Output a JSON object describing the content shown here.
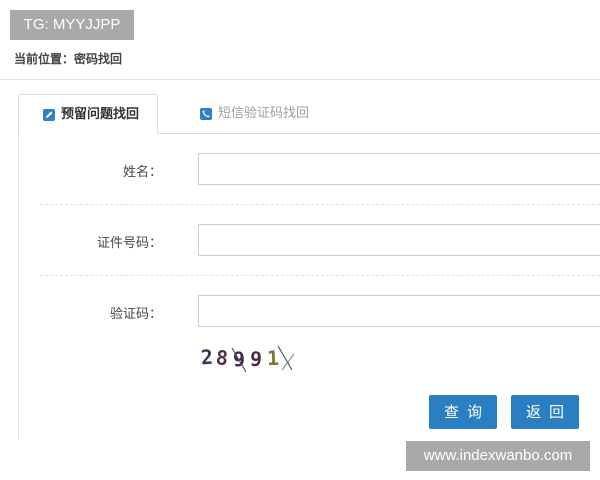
{
  "overlay": {
    "tg_label": "TG: MYYJJPP",
    "watermark": "www.indexwanbo.com"
  },
  "breadcrumb": {
    "text": "当前位置：密码找回"
  },
  "tabs": [
    {
      "label": "预留问题找回",
      "icon": "edit-icon",
      "active": true
    },
    {
      "label": "短信验证码找回",
      "icon": "phone-icon",
      "active": false
    }
  ],
  "form": {
    "name_label": "姓名：",
    "name_value": "",
    "id_label": "证件号码：",
    "id_value": "",
    "captcha_label": "验证码：",
    "captcha_value": "",
    "captcha_text": "28991"
  },
  "buttons": {
    "query": "查询",
    "back": "返回"
  },
  "colors": {
    "accent": "#2a7fc2",
    "overlay_bg": "#a9a9a9"
  }
}
